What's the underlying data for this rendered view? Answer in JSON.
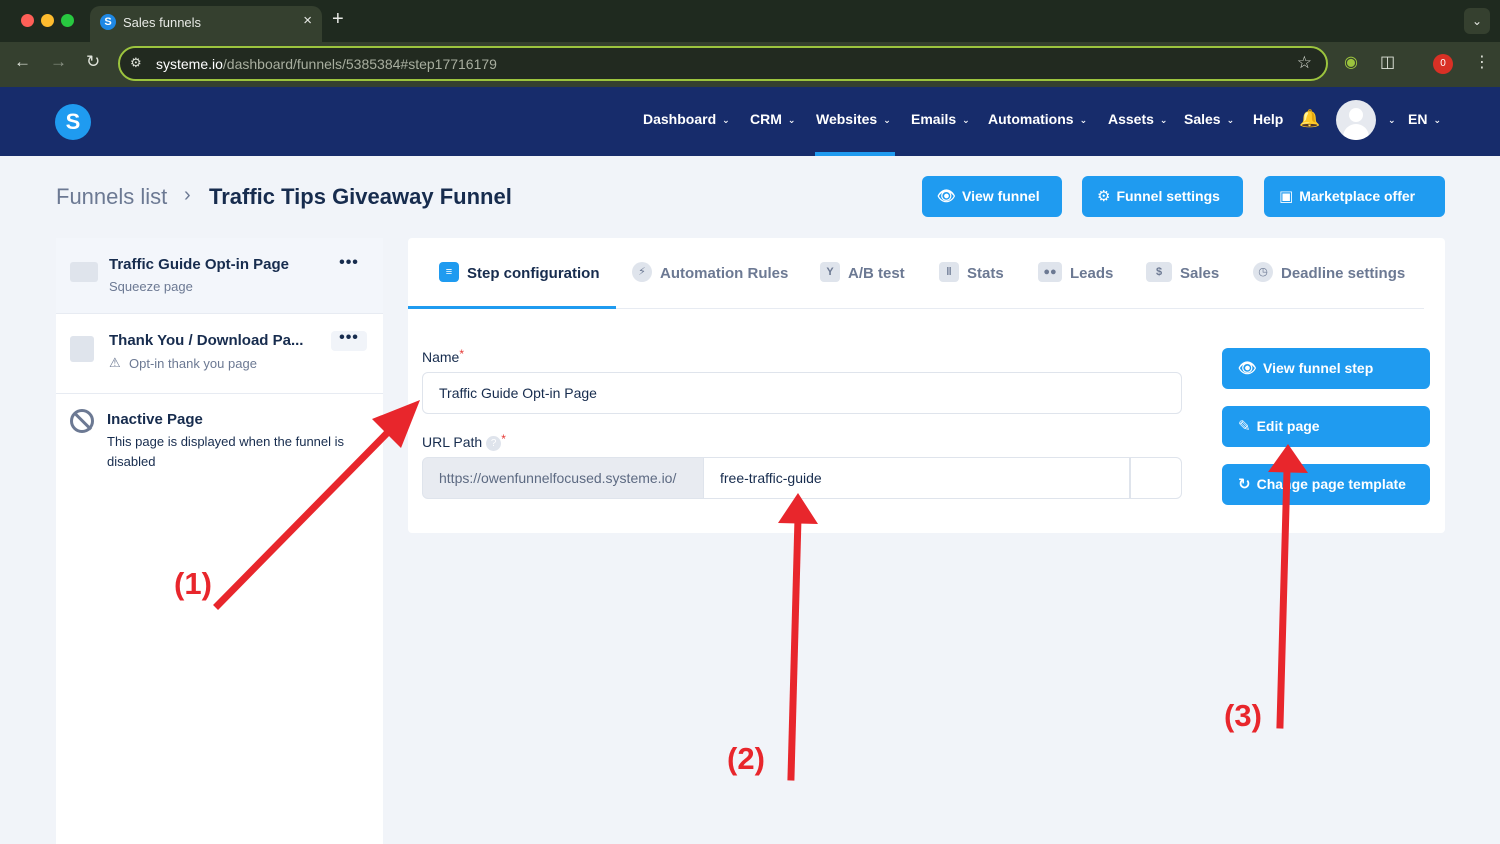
{
  "browser": {
    "tab_title": "Sales funnels",
    "tab_favicon": "S",
    "close_glyph": "×",
    "new_tab_glyph": "+",
    "tab_menu_glyph": "⌄",
    "url_host": "systeme.io",
    "url_path": "/dashboard/funnels/5385384#step17716179",
    "extension_badge": "0",
    "colors": {
      "tabbar": "#1f2a1f",
      "toolbar": "#35402f",
      "omnibox_border": "#9cc43e"
    }
  },
  "header": {
    "logo_letter": "S",
    "nav": [
      {
        "label": "Dashboard",
        "has_menu": true
      },
      {
        "label": "CRM",
        "has_menu": true
      },
      {
        "label": "Websites",
        "has_menu": true,
        "active": true
      },
      {
        "label": "Emails",
        "has_menu": true
      },
      {
        "label": "Automations",
        "has_menu": true
      },
      {
        "label": "Assets",
        "has_menu": true
      },
      {
        "label": "Sales",
        "has_menu": true
      },
      {
        "label": "Help",
        "has_menu": false
      }
    ],
    "language": "EN",
    "chevron": "⌄",
    "colors": {
      "background": "#172c6b",
      "accent": "#1f9bf0"
    }
  },
  "title_row": {
    "breadcrumb_parent": "Funnels list",
    "breadcrumb_sep": "›",
    "funnel_name": "Traffic Tips Giveaway Funnel",
    "view_funnel": "View funnel",
    "funnel_settings": "Funnel settings",
    "marketplace_offer": "Marketplace offer"
  },
  "sidebar": {
    "steps": [
      {
        "title": "Traffic Guide Opt-in Page",
        "subtitle": "Squeeze page",
        "menu": "•••",
        "active": true
      },
      {
        "title": "Thank You / Download Pa...",
        "subtitle": "Opt-in thank you page",
        "menu": "•••",
        "warning": true
      }
    ],
    "inactive": {
      "title": "Inactive Page",
      "description": "This page is displayed when the funnel is disabled"
    }
  },
  "tabs": [
    {
      "label": "Step configuration",
      "icon": "sliders-icon",
      "active": true
    },
    {
      "label": "Automation Rules",
      "icon": "bolt-icon"
    },
    {
      "label": "A/B test",
      "icon": "split-icon"
    },
    {
      "label": "Stats",
      "icon": "bar-chart-icon"
    },
    {
      "label": "Leads",
      "icon": "users-icon"
    },
    {
      "label": "Sales",
      "icon": "dollar-icon"
    },
    {
      "label": "Deadline settings",
      "icon": "clock-icon"
    }
  ],
  "form": {
    "name_label": "Name",
    "name_value": "Traffic Guide Opt-in Page",
    "url_label": "URL Path",
    "url_prefix": "https://owenfunnelfocused.systeme.io/",
    "url_value": "free-traffic-guide",
    "required_mark": "*",
    "help_mark": "?"
  },
  "actions": {
    "view_step": "View funnel step",
    "edit_page": "Edit page",
    "change_template": "Change page template"
  },
  "annotations": [
    "(1)",
    "(2)",
    "(3)"
  ],
  "annotation_color": "#e8262c"
}
